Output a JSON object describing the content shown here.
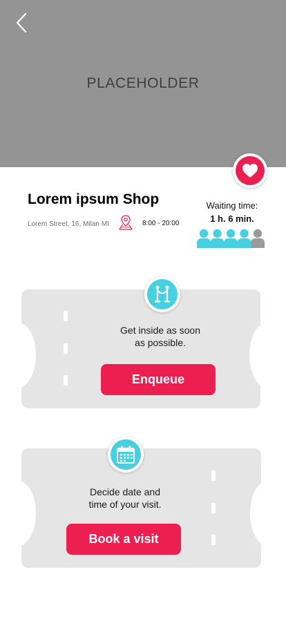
{
  "hero": {
    "placeholder": "PLACEHOLDER",
    "back_icon": "chevron-left-icon",
    "favorite_icon": "heart-icon"
  },
  "shop": {
    "name": "Lorem ipsum Shop",
    "address": "Lorem Street, 16, Milan MI",
    "hours": "8:00 - 20:00",
    "location_icon": "map-pin-icon"
  },
  "waiting": {
    "label": "Waiting time:",
    "value": "1 h. 6 min.",
    "queue_total": 5,
    "queue_filled": 4
  },
  "enqueue_card": {
    "icon": "stanchion-icon",
    "text_line1": "Get inside as soon",
    "text_line2": "as possible.",
    "button": "Enqueue"
  },
  "book_card": {
    "icon": "calendar-icon",
    "text_line1": "Decide date and",
    "text_line2": "time of your visit.",
    "button": "Book a visit"
  },
  "colors": {
    "accent": "#ed1e50",
    "secondary": "#47d1e0",
    "hero_bg": "#959495",
    "card_bg": "#e5e5e5",
    "person_empty": "#9a9a9a"
  }
}
